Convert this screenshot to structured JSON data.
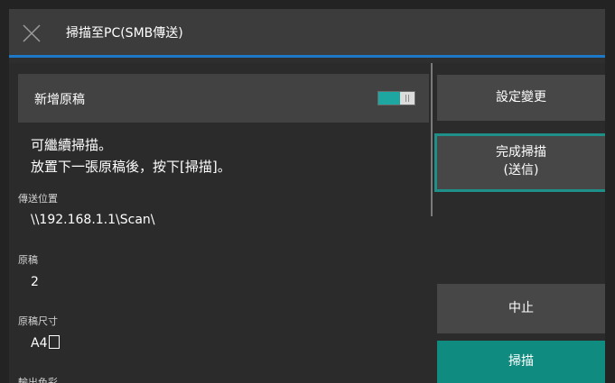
{
  "header": {
    "title": "掃描至PC(SMB傳送)",
    "close_icon": "close-icon"
  },
  "left": {
    "add_original": {
      "label": "新增原稿",
      "toggle_on": true
    },
    "messages": [
      "可繼續掃描。",
      "放置下一張原稿後，按下[掃描]。"
    ],
    "fields": [
      {
        "label": "傳送位置",
        "value": "\\\\192.168.1.1\\Scan\\"
      },
      {
        "label": "原稿",
        "value": "2"
      },
      {
        "label": "原稿尺寸",
        "value": "A4"
      },
      {
        "label": "輸出色彩",
        "value": ""
      }
    ],
    "size_orientation_icon": "portrait-page-icon"
  },
  "right": {
    "settings_button": "設定變更",
    "finish_button_line1": "完成掃描",
    "finish_button_line2": "(送信)",
    "stop_button": "中止",
    "scan_button": "掃描"
  },
  "colors": {
    "background": "#232323",
    "panel": "#2b2b2b",
    "header": "#3c3c3c",
    "accent_blue": "#1e78c8",
    "accent_teal": "#1f8f8a",
    "scan_button": "#0f8b80"
  }
}
